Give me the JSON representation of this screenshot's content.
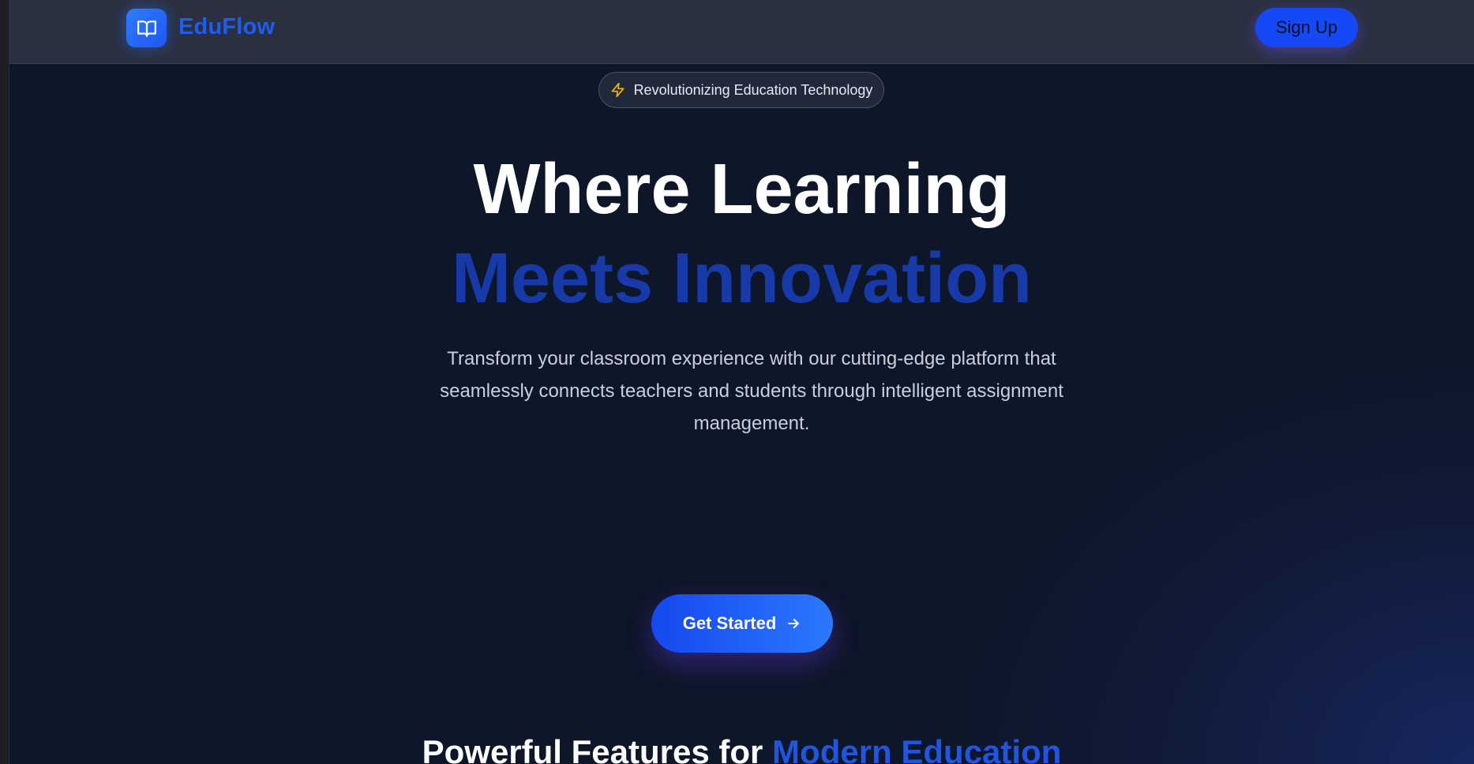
{
  "brand": {
    "name": "EduFlow",
    "icon": "book-open-icon",
    "color": "#1f5cf0"
  },
  "nav": {
    "signup_label": "Sign Up"
  },
  "hero": {
    "badge_icon": "lightning-icon",
    "badge_text": "Revolutionizing Education Technology",
    "title_line1": "Where Learning",
    "title_line2": "Meets Innovation",
    "subtitle": "Transform your classroom experience with our cutting-edge platform that seamlessly connects teachers and students through intelligent assignment management.",
    "cta_label": "Get Started",
    "cta_icon": "arrow-right-icon"
  },
  "features": {
    "heading_prefix": "Powerful Features for",
    "heading_accent": "Modern Education"
  },
  "colors": {
    "background": "#0e1629",
    "navbar": "#2a3040",
    "accent": "#1f55e0",
    "title_accent": "#173aa8",
    "badge_icon": "#f5b400"
  }
}
